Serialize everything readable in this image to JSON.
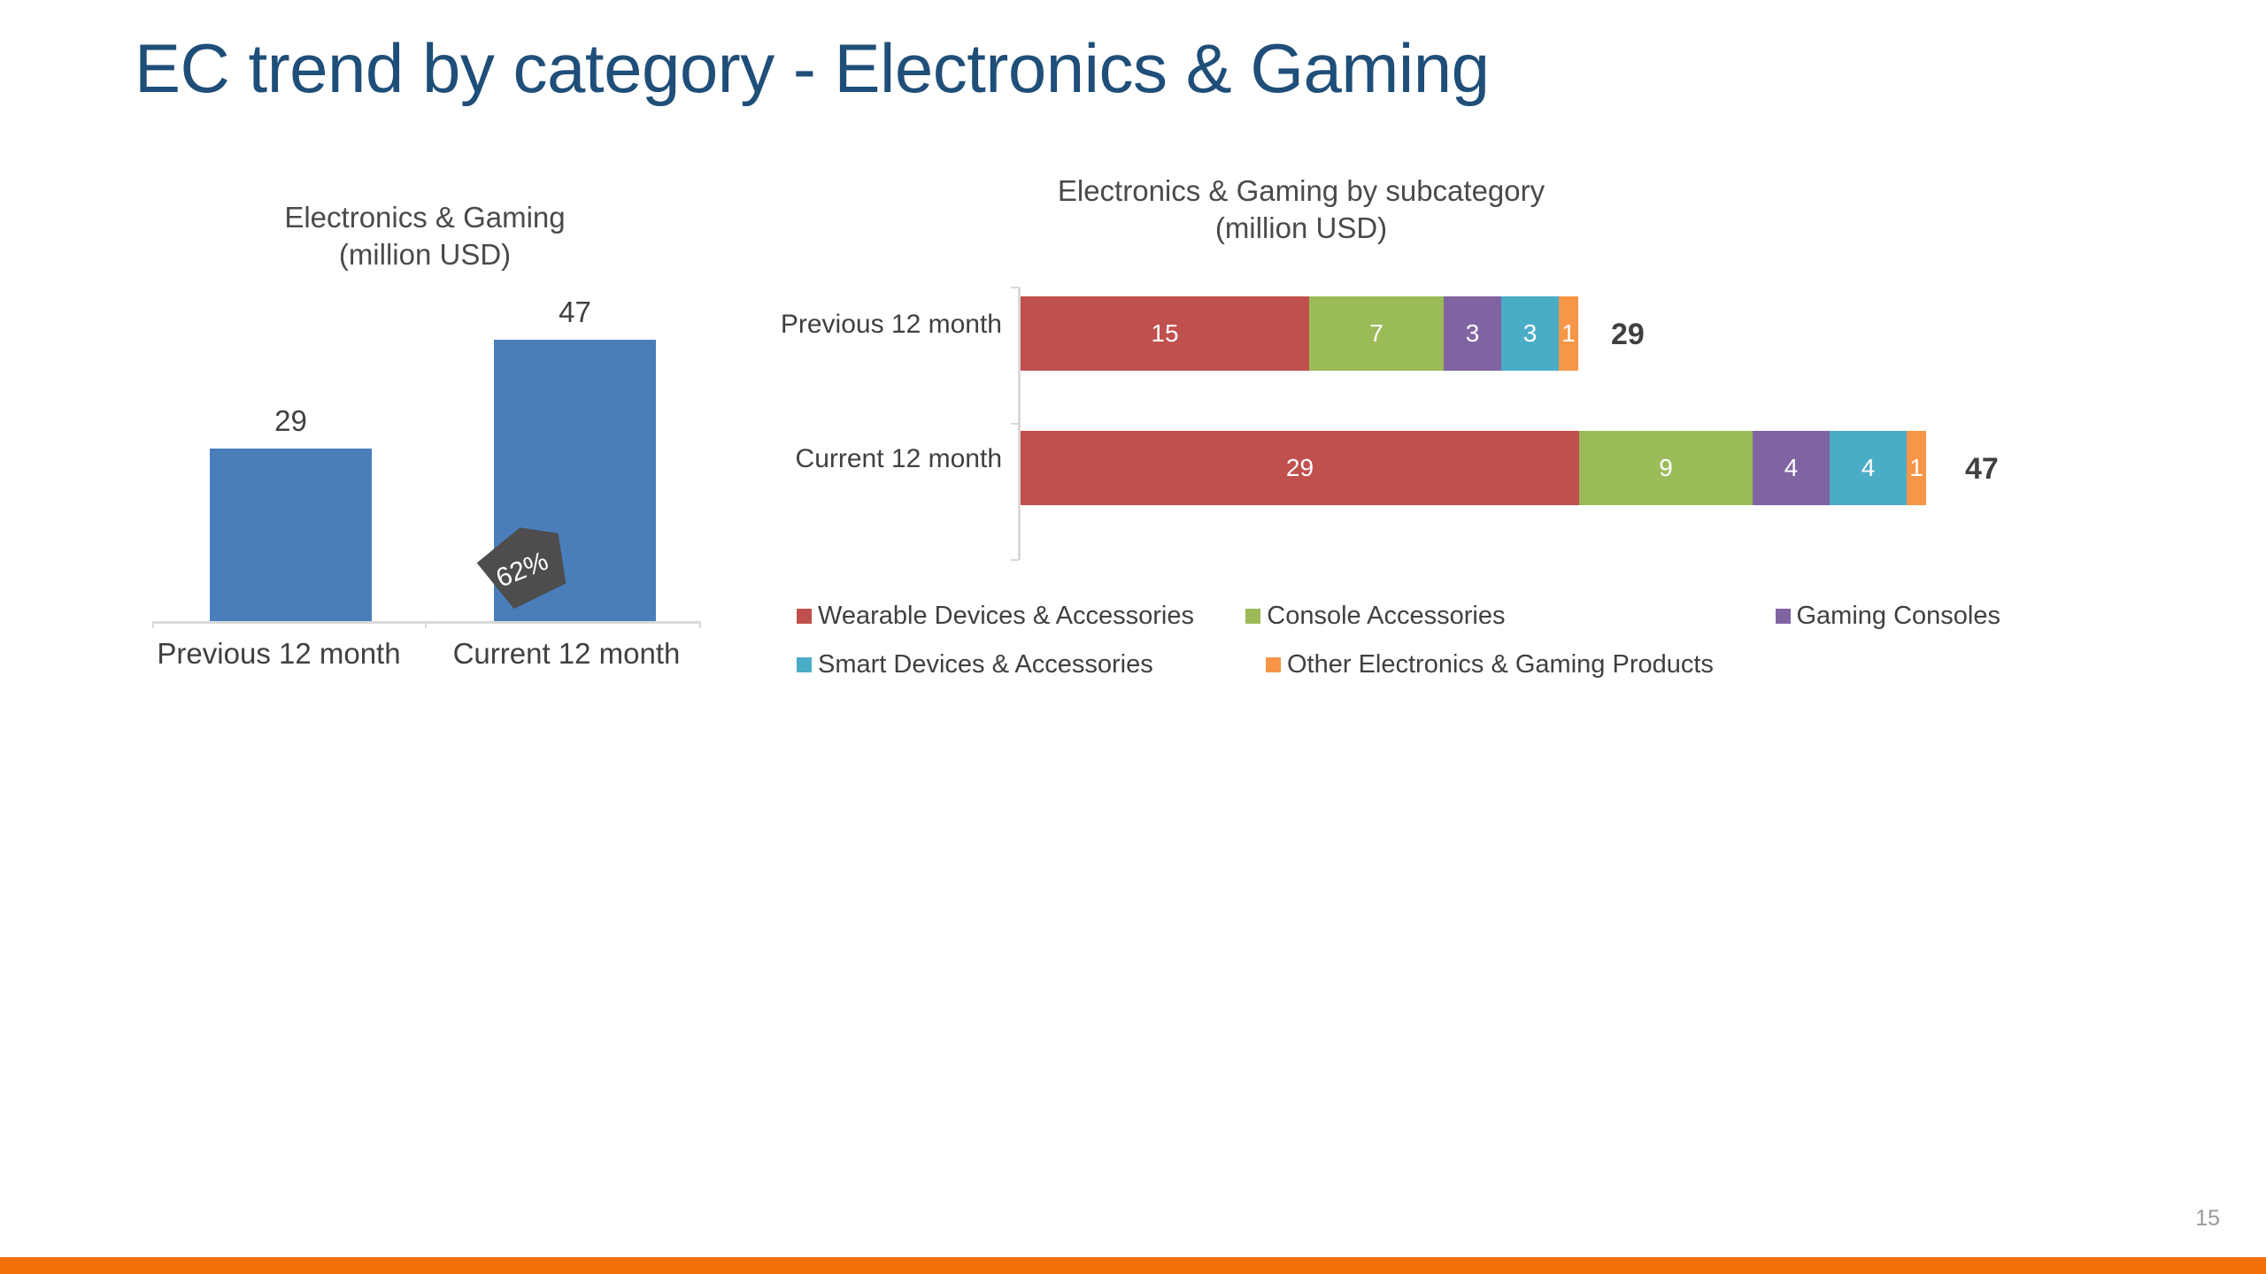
{
  "slide": {
    "title": "EC trend by category - Electronics & Gaming",
    "page_number": "15",
    "title_color": "#1F4E79",
    "footer_bar_color": "#F2700A"
  },
  "left_chart": {
    "title_line1": "Electronics & Gaming",
    "title_line2": "(million USD)",
    "bar_color": "#4A7EBB",
    "growth_badge": "62%",
    "growth_badge_color": "#4D4D4D"
  },
  "right_chart": {
    "title_line1": "Electronics & Gaming by subcategory",
    "title_line2": "(million USD)"
  },
  "legend": {
    "rows": [
      [
        {
          "label": "Wearable Devices & Accessories",
          "color": "#C0504D"
        },
        {
          "label": "Console Accessories",
          "color": "#9BBB59"
        },
        {
          "label": "Gaming Consoles",
          "color": "#8064A2"
        }
      ],
      [
        {
          "label": "Smart Devices & Accessories",
          "color": "#4BACC6"
        },
        {
          "label": "Other Electronics & Gaming Products",
          "color": "#F79646"
        }
      ]
    ]
  },
  "chart_data": [
    {
      "type": "bar",
      "title": "Electronics & Gaming (million USD)",
      "xlabel": "",
      "ylabel": "million USD",
      "categories": [
        "Previous 12 month",
        "Current 12 month"
      ],
      "values": [
        29,
        47
      ],
      "ylim": [
        0,
        47
      ],
      "grid": false,
      "legend": "none",
      "annotations": [
        {
          "text": "62%",
          "kind": "growth-callout",
          "between": [
            "Previous 12 month",
            "Current 12 month"
          ]
        }
      ],
      "data_labels": [
        "29",
        "47"
      ],
      "series_color": "#4A7EBB"
    },
    {
      "type": "bar",
      "orientation": "horizontal",
      "stacked": true,
      "title": "Electronics & Gaming by subcategory (million USD)",
      "xlabel": "",
      "ylabel": "",
      "categories": [
        "Previous 12 month",
        "Current 12 month"
      ],
      "series": [
        {
          "name": "Wearable Devices & Accessories",
          "color": "#C0504D",
          "values": [
            15,
            29
          ]
        },
        {
          "name": "Console Accessories",
          "color": "#9BBB59",
          "values": [
            7,
            9
          ]
        },
        {
          "name": "Gaming Consoles",
          "color": "#8064A2",
          "values": [
            3,
            4
          ]
        },
        {
          "name": "Smart Devices & Accessories",
          "color": "#4BACC6",
          "values": [
            3,
            4
          ]
        },
        {
          "name": "Other Electronics & Gaming Products",
          "color": "#F79646",
          "values": [
            1,
            1
          ]
        }
      ],
      "totals": [
        29,
        47
      ],
      "xlim": [
        0,
        47
      ],
      "grid": false,
      "legend": "bottom"
    }
  ]
}
